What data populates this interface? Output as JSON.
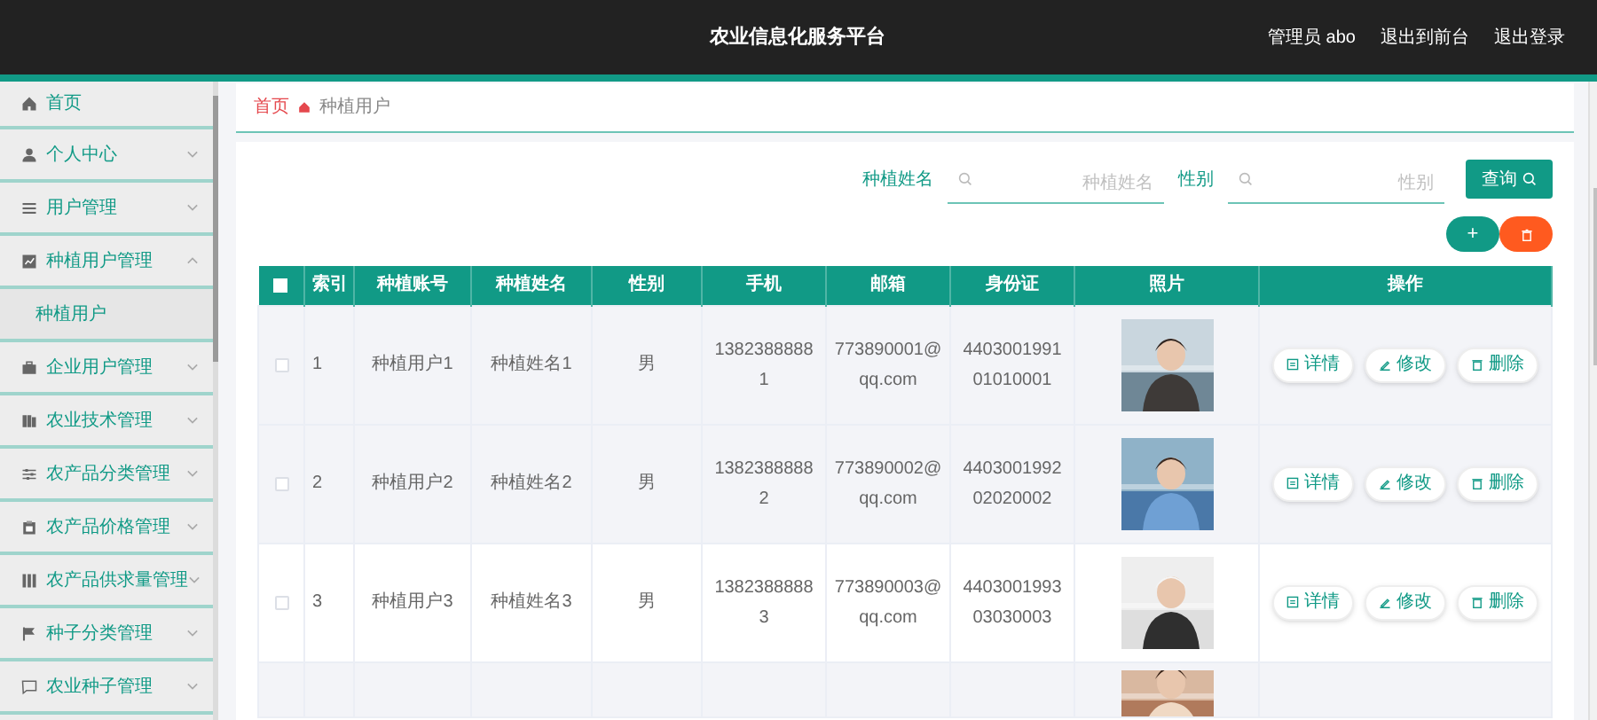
{
  "header": {
    "title": "农业信息化服务平台",
    "links": [
      "管理员 abo",
      "退出到前台",
      "退出登录"
    ]
  },
  "sidebar": {
    "items": [
      {
        "label": "首页"
      },
      {
        "label": "个人中心",
        "expanded": false
      },
      {
        "label": "用户管理",
        "expanded": false
      },
      {
        "label": "种植用户管理",
        "expanded": true,
        "children": [
          {
            "label": "种植用户",
            "selected": true
          }
        ]
      },
      {
        "label": "企业用户管理",
        "expanded": false
      },
      {
        "label": "农业技术管理",
        "expanded": false
      },
      {
        "label": "农产品分类管理",
        "expanded": false
      },
      {
        "label": "农产品价格管理",
        "expanded": false
      },
      {
        "label": "农产品供求量管理",
        "expanded": false
      },
      {
        "label": "种子分类管理",
        "expanded": false
      },
      {
        "label": "农业种子管理",
        "expanded": false
      }
    ]
  },
  "breadcrumb": [
    "首页",
    "种植用户"
  ],
  "search": {
    "fields": [
      {
        "label": "种植姓名",
        "placeholder": "种植姓名"
      },
      {
        "label": "性别",
        "placeholder": "性别"
      }
    ],
    "button": "查询"
  },
  "actions": {
    "add": "+"
  },
  "table": {
    "all_checked": false,
    "columns": [
      "索引",
      "种植账号",
      "种植姓名",
      "性别",
      "手机",
      "邮箱",
      "身份证",
      "照片",
      "操作"
    ],
    "rows": [
      {
        "checked": false,
        "cells": [
          "1",
          "种植用户1",
          "种植姓名1",
          "男",
          "13823888881",
          "773890001@qq.com",
          "440300199101010001"
        ],
        "buttons": [
          "详情",
          "修改",
          "删除"
        ]
      },
      {
        "checked": false,
        "cells": [
          "2",
          "种植用户2",
          "种植姓名2",
          "男",
          "13823888882",
          "773890002@qq.com",
          "440300199202020002"
        ],
        "buttons": [
          "详情",
          "修改",
          "删除"
        ]
      },
      {
        "checked": false,
        "cells": [
          "3",
          "种植用户3",
          "种植姓名3",
          "男",
          "13823888883",
          "773890003@qq.com",
          "440300199303030003"
        ],
        "buttons": [
          "详情",
          "修改",
          "删除"
        ]
      }
    ]
  }
}
